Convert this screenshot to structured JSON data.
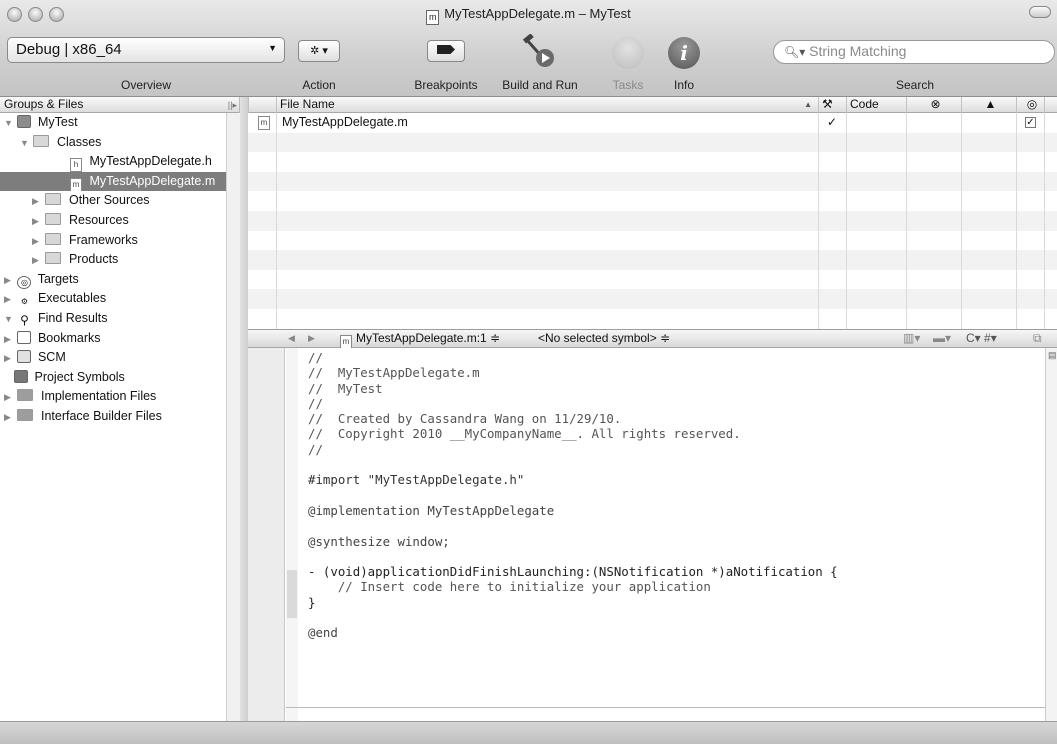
{
  "window": {
    "title": "MyTestAppDelegate.m – MyTest",
    "doc_glyph": "m"
  },
  "toolbar": {
    "scheme": "Debug | x86_64",
    "overview_label": "Overview",
    "action_label": "Action",
    "breakpoints_label": "Breakpoints",
    "build_and_run_label": "Build and Run",
    "tasks_label": "Tasks",
    "info_label": "Info",
    "search_label": "Search",
    "search_placeholder": "String Matching",
    "info_glyph": "i"
  },
  "sidebar": {
    "header": "Groups & Files",
    "items": [
      {
        "label": "MyTest"
      },
      {
        "label": "Classes"
      },
      {
        "label": "MyTestAppDelegate.h",
        "badge": "h"
      },
      {
        "label": "MyTestAppDelegate.m",
        "badge": "m"
      },
      {
        "label": "Other Sources"
      },
      {
        "label": "Resources"
      },
      {
        "label": "Frameworks"
      },
      {
        "label": "Products"
      },
      {
        "label": "Targets"
      },
      {
        "label": "Executables"
      },
      {
        "label": "Find Results"
      },
      {
        "label": "Bookmarks"
      },
      {
        "label": "SCM"
      },
      {
        "label": "Project Symbols"
      },
      {
        "label": "Implementation Files"
      },
      {
        "label": "Interface Builder Files"
      }
    ]
  },
  "detail": {
    "col_file_name": "File Name",
    "col_code": "Code",
    "rows": [
      {
        "file_name": "MyTestAppDelegate.m",
        "badge": "m",
        "build_mark": "✓",
        "target_checked": "✓"
      }
    ]
  },
  "editor": {
    "nav_file": "MyTestAppDelegate.m:1 ≑",
    "nav_symbol": "<No selected symbol> ≑",
    "nav_tools": "C▾  #▾",
    "code_lines": [
      "//",
      "//  MyTestAppDelegate.m",
      "//  MyTest",
      "//",
      "//  Created by Cassandra Wang on 11/29/10.",
      "//  Copyright 2010 __MyCompanyName__. All rights reserved.",
      "//",
      "",
      "#import \"MyTestAppDelegate.h\"",
      "",
      "@implementation MyTestAppDelegate",
      "",
      "@synthesize window;",
      "",
      "- (void)applicationDidFinishLaunching:(NSNotification *)aNotification {",
      "    // Insert code here to initialize your application",
      "}",
      "",
      "@end"
    ]
  }
}
